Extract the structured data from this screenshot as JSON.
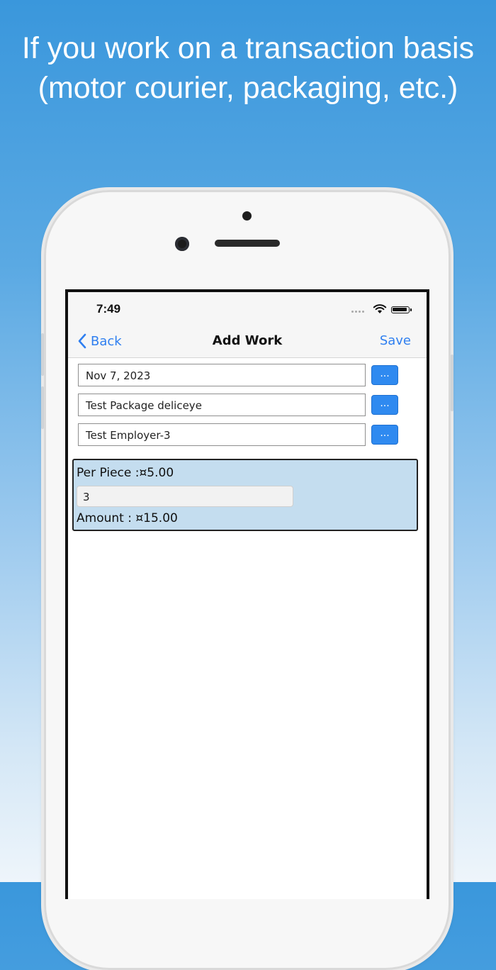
{
  "headline": {
    "line1": "If you work on a transaction basis",
    "line2": "(motor courier, packaging, etc.)"
  },
  "status_bar": {
    "time": "7:49"
  },
  "navbar": {
    "back_label": "Back",
    "title": "Add Work",
    "save_label": "Save"
  },
  "form": {
    "date_value": "Nov 7, 2023",
    "package_value": "Test Package deliceye",
    "employer_value": "Test Employer-3",
    "picker_button_label": "..."
  },
  "panel": {
    "per_piece_text": "Per Piece :¤5.00",
    "quantity_value": "3",
    "amount_text": "Amount : ¤15.00"
  },
  "colors": {
    "accent": "#2f7ff0",
    "panel_bg": "#c4ddef",
    "button_blue": "#2f8af0"
  }
}
